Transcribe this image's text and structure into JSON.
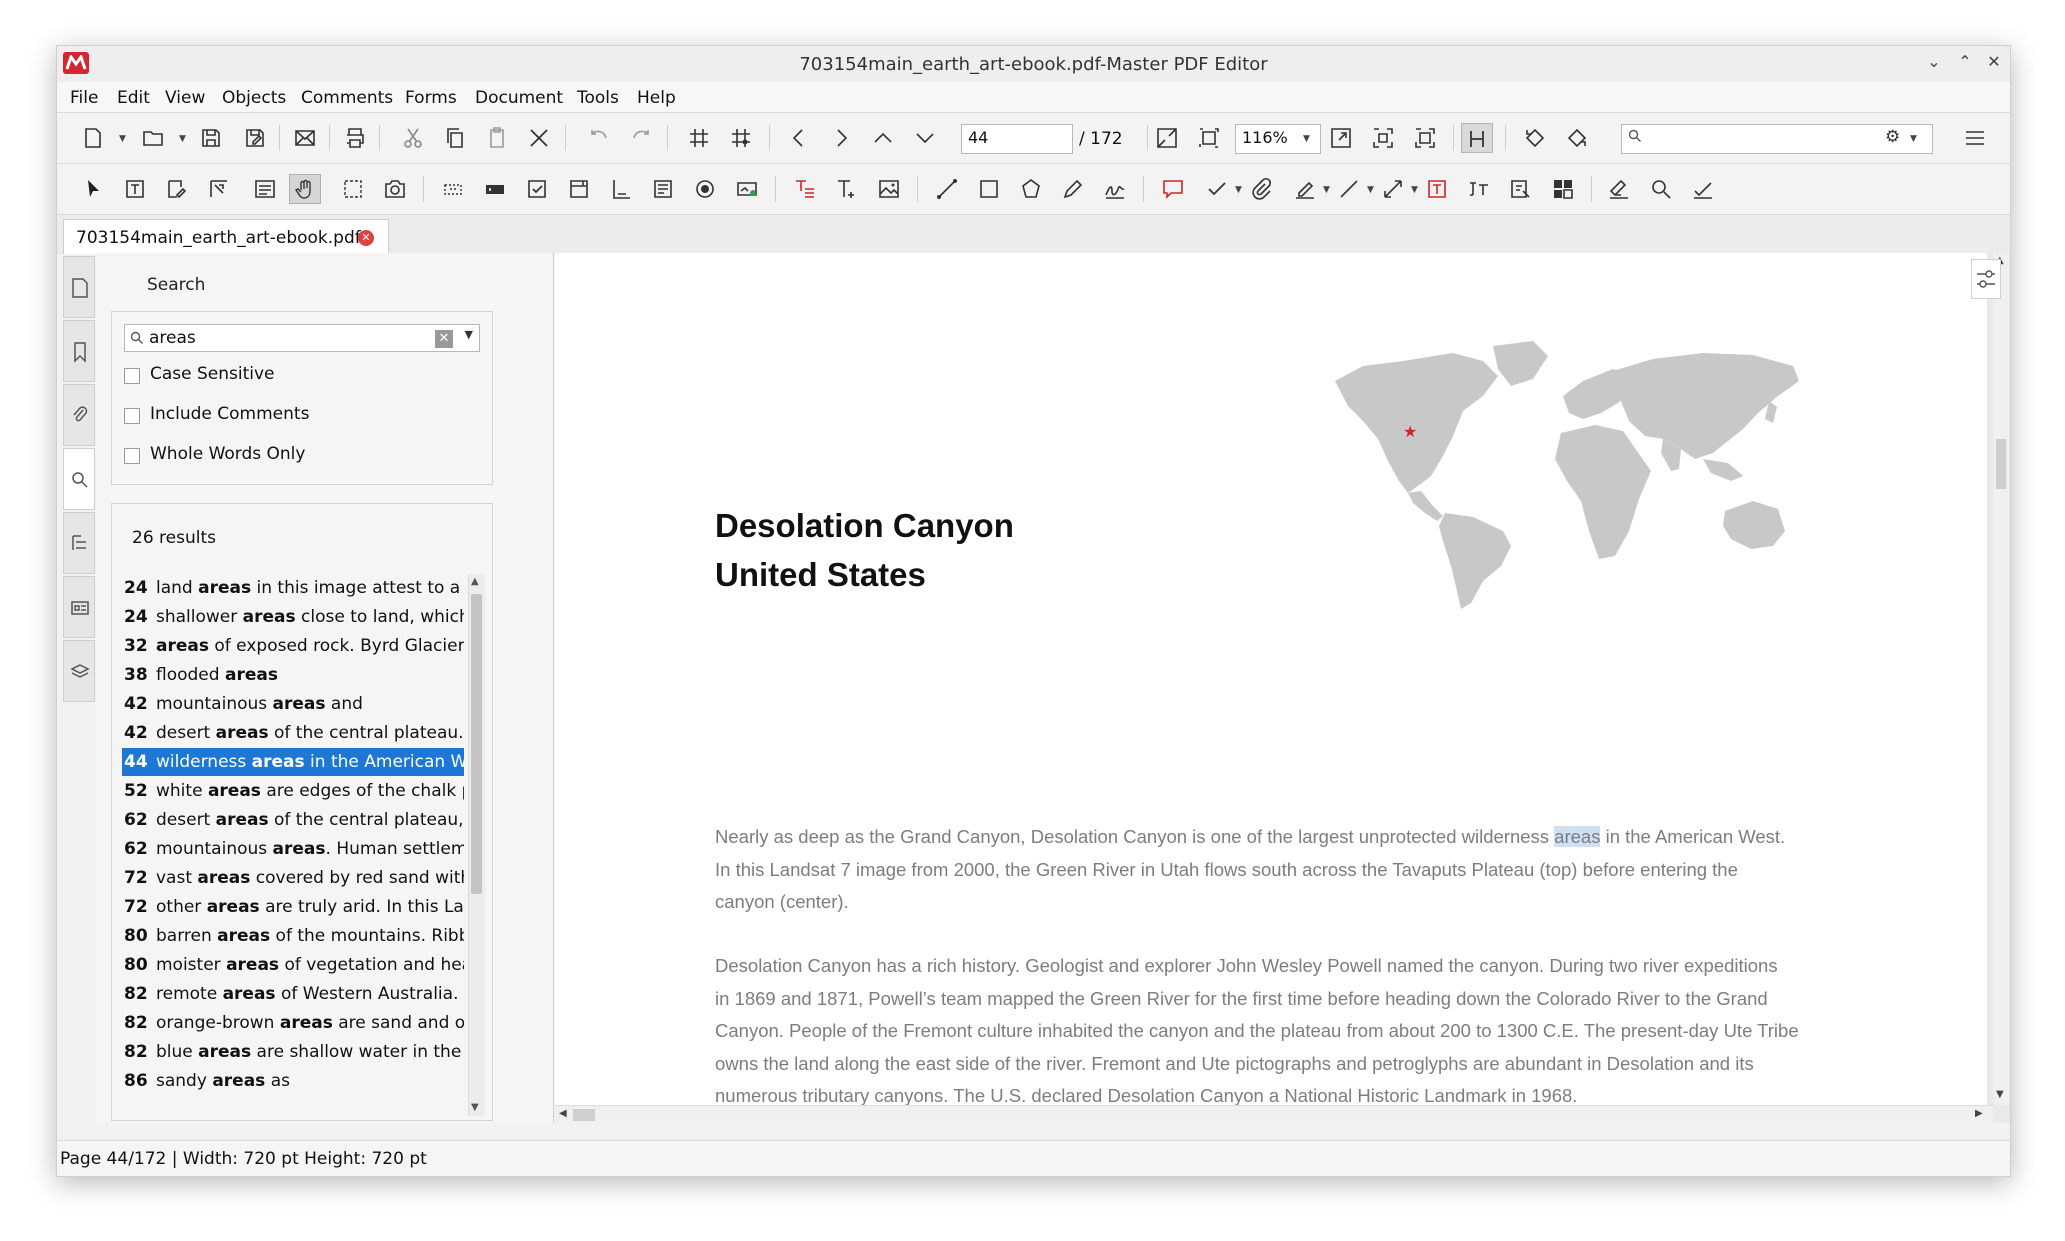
{
  "window": {
    "title": "703154main_earth_art-ebook.pdf-Master PDF Editor"
  },
  "menu": [
    "File",
    "Edit",
    "View",
    "Objects",
    "Comments",
    "Forms",
    "Document",
    "Tools",
    "Help"
  ],
  "toolbar": {
    "page_input": "44",
    "page_total": "/ 172",
    "zoom": "116%",
    "search_placeholder": ""
  },
  "tab": {
    "label": "703154main_earth_art-ebook.pdf"
  },
  "search_panel": {
    "title": "Search",
    "query": "areas",
    "options": [
      "Case Sensitive",
      "Include Comments",
      "Whole Words Only"
    ],
    "results_count": "26 results",
    "results": [
      {
        "page": "24",
        "pre": "land ",
        "match": "areas",
        "post": " in this image attest to a lack"
      },
      {
        "page": "24",
        "pre": "shallower ",
        "match": "areas",
        "post": " close to land, which a"
      },
      {
        "page": "32",
        "pre": "",
        "match": "areas",
        "post": " of exposed rock. Byrd Glacier is"
      },
      {
        "page": "38",
        "pre": "flooded ",
        "match": "areas",
        "post": ""
      },
      {
        "page": "42",
        "pre": "mountainous ",
        "match": "areas",
        "post": " and"
      },
      {
        "page": "42",
        "pre": "desert ",
        "match": "areas",
        "post": " of the central plateau. Th"
      },
      {
        "page": "44",
        "pre": "wilderness ",
        "match": "areas",
        "post": " in the American West"
      },
      {
        "page": "52",
        "pre": "white ",
        "match": "areas",
        "post": " are edges of the chalk pla"
      },
      {
        "page": "62",
        "pre": "desert ",
        "match": "areas",
        "post": " of the central plateau, wh"
      },
      {
        "page": "62",
        "pre": "mountainous ",
        "match": "areas",
        "post": ". Human settlemen"
      },
      {
        "page": "72",
        "pre": "vast ",
        "match": "areas",
        "post": " covered by red sand withou"
      },
      {
        "page": "72",
        "pre": "other ",
        "match": "areas",
        "post": " are truly arid. In this Land"
      },
      {
        "page": "80",
        "pre": "barren ",
        "match": "areas",
        "post": " of the mountains. Ribbo"
      },
      {
        "page": "80",
        "pre": "moister ",
        "match": "areas",
        "post": " of vegetation and heavy"
      },
      {
        "page": "82",
        "pre": "remote ",
        "match": "areas",
        "post": " of Western Australia."
      },
      {
        "page": "82",
        "pre": "orange-brown ",
        "match": "areas",
        "post": " are sand and out"
      },
      {
        "page": "82",
        "pre": "blue ",
        "match": "areas",
        "post": " are shallow water in the we"
      },
      {
        "page": "86",
        "pre": "sandy ",
        "match": "areas",
        "post": " as"
      }
    ],
    "selected_index": 6
  },
  "document": {
    "heading_line1": "Desolation Canyon",
    "heading_line2": "United States",
    "para1": [
      {
        "pre": "Nearly as deep as the Grand Canyon, Desolation Canyon is one of the largest unprotected wilderness ",
        "hl": "areas",
        "post": " in the American West."
      },
      {
        "pre": "In this Landsat 7 image from 2000, the Green River in Utah flows south across the Tavaputs Plateau (top) before entering the",
        "hl": "",
        "post": ""
      },
      {
        "pre": "canyon (center).",
        "hl": "",
        "post": ""
      }
    ],
    "para2": [
      "Desolation Canyon has a rich history. Geologist and explorer John Wesley Powell named the canyon. During two river expeditions",
      "in 1869 and 1871, Powell’s team mapped the Green River for the first time before heading down the Colorado River to the Grand",
      "Canyon. People of the Fremont culture inhabited the canyon and the plateau from about 200 to 1300 C.E. The present-day Ute Tribe",
      "owns the land along the east side of the river. Fremont and Ute pictographs and petroglyphs are abundant in Desolation and its",
      "numerous tributary canyons. The U.S. declared Desolation Canyon a National Historic Landmark in 1968."
    ],
    "map_marker_color": "#d0252b",
    "map_land_color": "#c8c8c8"
  },
  "status": {
    "text": "Page 44/172 | Width: 720 pt Height: 720 pt"
  }
}
